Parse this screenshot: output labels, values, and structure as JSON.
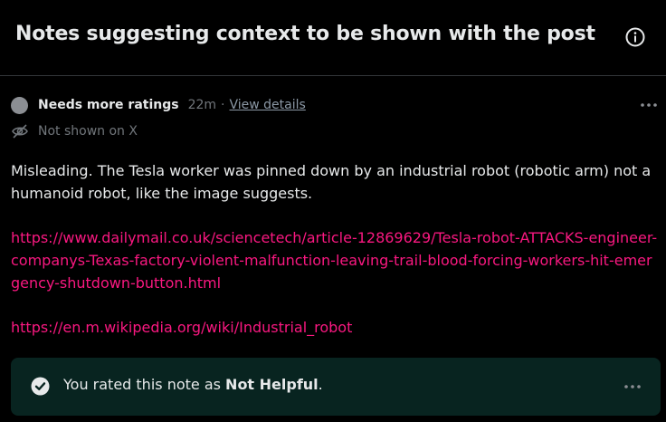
{
  "header": {
    "title": "Notes suggesting context to be shown with the post",
    "info_icon": "info-circle-icon"
  },
  "note": {
    "status": "Needs more ratings",
    "time": "22m",
    "separator": "·",
    "view_details": "View details",
    "shown_status": "Not shown on X",
    "body": "Misleading. The Tesla worker was pinned down by an industrial robot (robotic arm) not a humanoid robot, like the image suggests.",
    "links": [
      "https://www.dailymail.co.uk/sciencetech/article-12869629/Tesla-robot-ATTACKS-engineer-companys-Texas-factory-violent-malfunction-leaving-trail-blood-forcing-workers-hit-emergency-shutdown-button.html",
      "https://en.m.wikipedia.org/wiki/Industrial_robot"
    ]
  },
  "rating": {
    "prefix": "You rated this note as ",
    "value": "Not Helpful",
    "suffix": "."
  },
  "colors": {
    "background": "#000000",
    "text": "#e7e9ea",
    "muted": "#71767b",
    "link": "#f91880",
    "rated_box": "#082420"
  }
}
